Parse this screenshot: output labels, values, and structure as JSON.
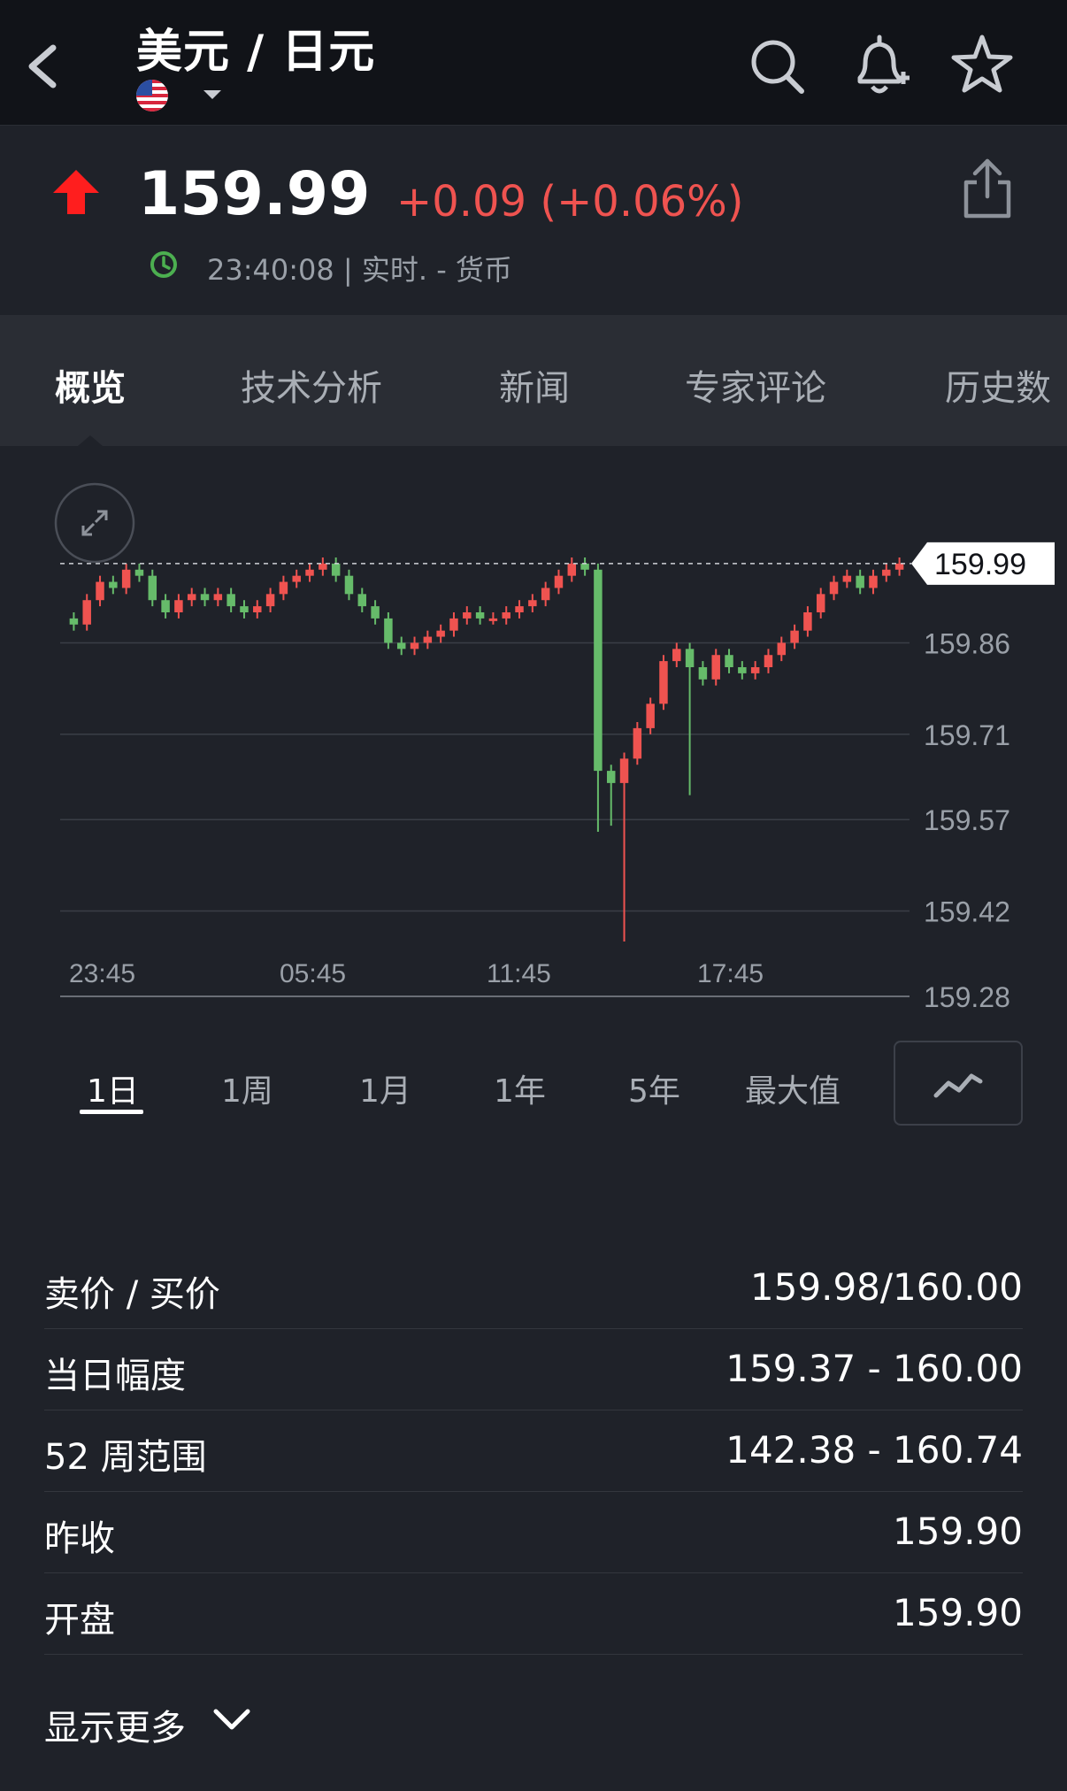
{
  "header": {
    "title": "美元 / 日元"
  },
  "quote": {
    "price": "159.99",
    "change": "+0.09 (+0.06%)",
    "status": "23:40:08 | 实时.  - 货币",
    "change_color": "#ef5350",
    "up_color": "#ff1e1e"
  },
  "tabs": [
    {
      "label": "概览",
      "active": true
    },
    {
      "label": "技术分析"
    },
    {
      "label": "新闻"
    },
    {
      "label": "专家评论"
    },
    {
      "label": "历史数"
    }
  ],
  "chart_data": {
    "type": "candlestick",
    "current_price_label": "159.99",
    "y_tick_labels": [
      "159.86",
      "159.71",
      "159.57",
      "159.42",
      "159.28"
    ],
    "x_tick_labels": [
      "23:45",
      "05:45",
      "11:45",
      "17:45"
    ],
    "ylim": [
      159.28,
      160.0
    ],
    "up_color": "#ef5350",
    "down_color": "#66bb6a",
    "close": [
      159.89,
      159.93,
      159.96,
      159.95,
      159.98,
      159.97,
      159.93,
      159.91,
      159.93,
      159.94,
      159.93,
      159.94,
      159.92,
      159.91,
      159.92,
      159.94,
      159.96,
      159.97,
      159.98,
      159.99,
      159.97,
      159.94,
      159.92,
      159.9,
      159.86,
      159.85,
      159.86,
      159.87,
      159.88,
      159.9,
      159.91,
      159.9,
      159.9,
      159.91,
      159.92,
      159.93,
      159.95,
      159.97,
      159.99,
      159.98,
      159.65,
      159.63,
      159.67,
      159.72,
      159.76,
      159.83,
      159.85,
      159.82,
      159.8,
      159.84,
      159.82,
      159.81,
      159.82,
      159.84,
      159.86,
      159.88,
      159.91,
      159.94,
      159.96,
      159.97,
      159.95,
      159.97,
      159.98,
      159.99
    ]
  },
  "ranges": [
    "1日",
    "1周",
    "1月",
    "1年",
    "5年",
    "最大值"
  ],
  "stats": [
    {
      "label": "卖价 / 买价",
      "value": "159.98/160.00"
    },
    {
      "label": "当日幅度",
      "value": "159.37 - 160.00"
    },
    {
      "label": "52 周范围",
      "value": "142.38 - 160.74"
    },
    {
      "label": "昨收",
      "value": "159.90"
    },
    {
      "label": "开盘",
      "value": "159.90"
    }
  ],
  "show_more": "显示更多"
}
